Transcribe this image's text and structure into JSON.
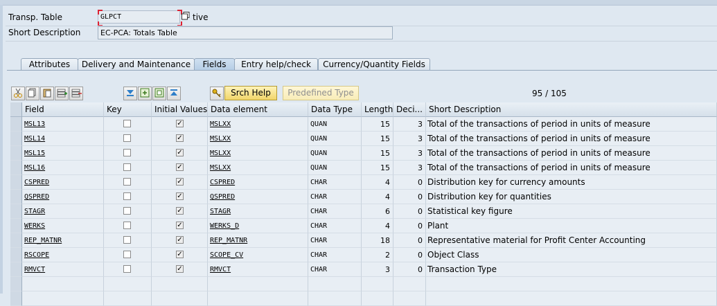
{
  "header": {
    "transp_table_label": "Transp. Table",
    "transp_table_value": "GLPCT",
    "status_suffix": "tive",
    "short_desc_label": "Short Description",
    "short_desc_value": "EC-PCA: Totals Table"
  },
  "tabs": [
    {
      "label": "Attributes",
      "active": false
    },
    {
      "label": "Delivery and Maintenance",
      "active": false
    },
    {
      "label": "Fields",
      "active": true
    },
    {
      "label": "Entry help/check",
      "active": false
    },
    {
      "label": "Currency/Quantity Fields",
      "active": false
    }
  ],
  "toolbar": {
    "icons": [
      "cut-icon",
      "copy-icon",
      "paste-icon",
      "insert-row-icon",
      "delete-row-icon",
      "move-down-icon",
      "new-field-icon",
      "copy-field-icon",
      "move-up-icon",
      "key-help-icon"
    ],
    "srch_help_label": "Srch Help",
    "predefined_type_label": "Predefined Type",
    "counter": "95 / 105"
  },
  "columns": [
    "Field",
    "Key",
    "Initial Values",
    "Data element",
    "Data Type",
    "Length",
    "Deci...",
    "Short Description"
  ],
  "rows": [
    {
      "field": "MSL13",
      "key": false,
      "initial": true,
      "data_element": "MSLXX",
      "data_type": "QUAN",
      "length": "15",
      "decimals": "3",
      "desc": "Total of the transactions of period in units of measure"
    },
    {
      "field": "MSL14",
      "key": false,
      "initial": true,
      "data_element": "MSLXX",
      "data_type": "QUAN",
      "length": "15",
      "decimals": "3",
      "desc": "Total of the transactions of period in units of measure"
    },
    {
      "field": "MSL15",
      "key": false,
      "initial": true,
      "data_element": "MSLXX",
      "data_type": "QUAN",
      "length": "15",
      "decimals": "3",
      "desc": "Total of the transactions of period in units of measure"
    },
    {
      "field": "MSL16",
      "key": false,
      "initial": true,
      "data_element": "MSLXX",
      "data_type": "QUAN",
      "length": "15",
      "decimals": "3",
      "desc": "Total of the transactions of period in units of measure"
    },
    {
      "field": "CSPRED",
      "key": false,
      "initial": true,
      "data_element": "CSPRED",
      "data_type": "CHAR",
      "length": "4",
      "decimals": "0",
      "desc": "Distribution key for currency amounts"
    },
    {
      "field": "QSPRED",
      "key": false,
      "initial": true,
      "data_element": "QSPRED",
      "data_type": "CHAR",
      "length": "4",
      "decimals": "0",
      "desc": "Distribution key for quantities"
    },
    {
      "field": "STAGR",
      "key": false,
      "initial": true,
      "data_element": "STAGR",
      "data_type": "CHAR",
      "length": "6",
      "decimals": "0",
      "desc": "Statistical key figure"
    },
    {
      "field": "WERKS",
      "key": false,
      "initial": true,
      "data_element": "WERKS_D",
      "data_type": "CHAR",
      "length": "4",
      "decimals": "0",
      "desc": "Plant"
    },
    {
      "field": "REP_MATNR",
      "key": false,
      "initial": true,
      "data_element": "REP_MATNR",
      "data_type": "CHAR",
      "length": "18",
      "decimals": "0",
      "desc": "Representative material for Profit Center Accounting"
    },
    {
      "field": "RSCOPE",
      "key": false,
      "initial": true,
      "data_element": "SCOPE_CV",
      "data_type": "CHAR",
      "length": "2",
      "decimals": "0",
      "desc": "Object Class"
    },
    {
      "field": "RMVCT",
      "key": false,
      "initial": true,
      "data_element": "RMVCT",
      "data_type": "CHAR",
      "length": "3",
      "decimals": "0",
      "desc": "Transaction Type"
    }
  ],
  "colors": {
    "background": "#dfe8f1",
    "tab_active": "#b5cde5",
    "button_yellow": "#f1d56a"
  }
}
